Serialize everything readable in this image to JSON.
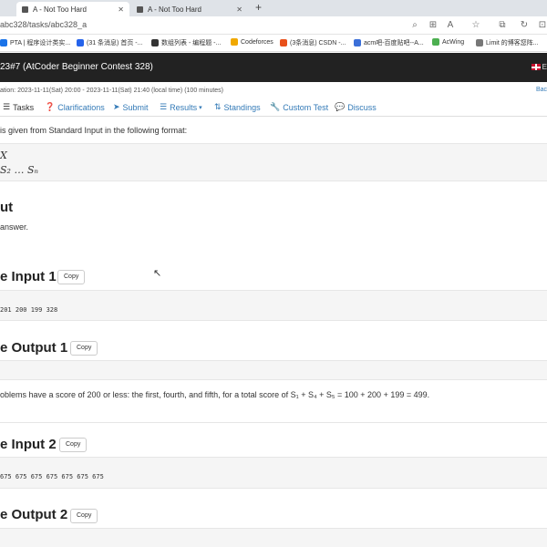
{
  "browser": {
    "tabs": [
      {
        "label": "A - Not Too Hard"
      },
      {
        "label": "A - Not Too Hard"
      }
    ],
    "url": "abc328/tasks/abc328_a",
    "bookmarks": [
      {
        "label": "PTA | 程序设计类实...",
        "color": "#1a73e8"
      },
      {
        "label": "(31 条消息) 首页 -...",
        "color": "#2563eb"
      },
      {
        "label": "数组列表 - 编程题 -...",
        "color": "#333333"
      },
      {
        "label": "Codeforces",
        "color": "#f0a800"
      },
      {
        "label": "(3条消息) CSDN -...",
        "color": "#e8501a"
      },
      {
        "label": "acm吧-百度贴吧--A...",
        "color": "#3b6fd8"
      },
      {
        "label": "AcWing",
        "color": "#4caf50"
      },
      {
        "label": "Limit 的博客您阵...",
        "color": "#777777"
      }
    ]
  },
  "header": {
    "title": "23#7  (AtCoder Beginner Contest 328)",
    "lang": "E"
  },
  "contest": {
    "duration": "ation: 2023-11-11(Sat) 20:00 - 2023-11-11(Sat) 21:40 (local time) (100 minutes)",
    "back": "Bac"
  },
  "nav": [
    {
      "label": "Tasks",
      "icon": "list-icon"
    },
    {
      "label": "Clarifications",
      "icon": "question-icon"
    },
    {
      "label": "Submit",
      "icon": "send-icon"
    },
    {
      "label": "Results",
      "icon": "list-icon"
    },
    {
      "label": "Standings",
      "icon": "sort-icon"
    },
    {
      "label": "Custom Test",
      "icon": "wrench-icon"
    },
    {
      "label": "Discuss",
      "icon": "chat-icon"
    }
  ],
  "content": {
    "input_format_intro": "is given from Standard Input in the following format:",
    "format_line1": "X",
    "format_line2": "S₂ … Sₙ",
    "output_heading": "ut",
    "output_text": "answer.",
    "sample_input_1_heading": "e Input 1",
    "sample_input_1": "201 200 199 328",
    "sample_output_1_heading": "e Output 1",
    "explanation_1": "oblems have a score of 200 or less: the first, fourth, and fifth, for a total score of S₁ + S₄ + S₅ = 100 + 200 + 199 = 499.",
    "sample_input_2_heading": "e Input 2",
    "sample_input_2": "675 675 675 675 675 675 675",
    "sample_output_2_heading": "e Output 2",
    "copy_label": "Copy"
  }
}
